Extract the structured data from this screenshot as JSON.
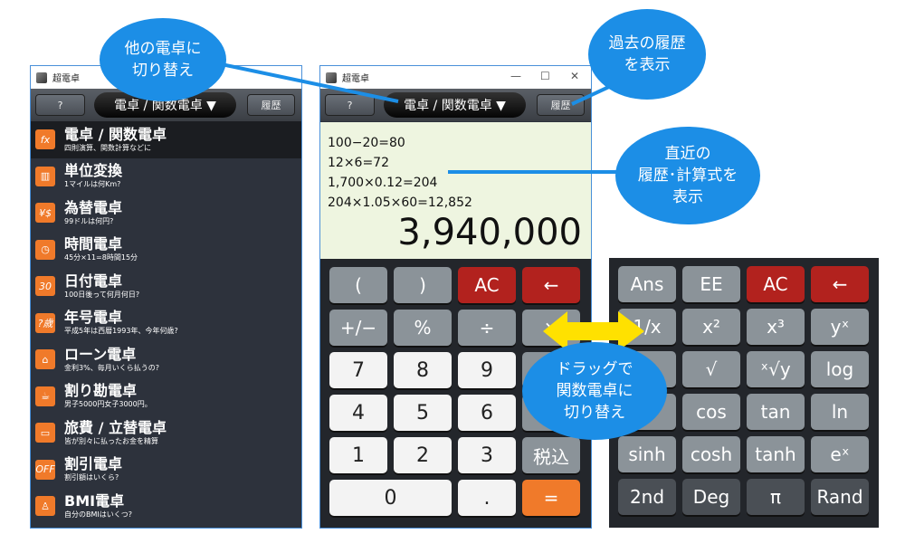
{
  "app_title": "超電卓",
  "toolbar": {
    "help": "?",
    "mode": "電卓 / 関数電卓 ▼",
    "history": "履歴"
  },
  "menu": [
    {
      "title": "電卓 / 関数電卓",
      "sub": "四則演算、関数計算などに",
      "icon": "fx-icon",
      "glyph": "fx",
      "selected": true
    },
    {
      "title": "単位変換",
      "sub": "1マイルは何Km?",
      "icon": "ruler-icon",
      "glyph": "▥"
    },
    {
      "title": "為替電卓",
      "sub": "99ドルは何円?",
      "icon": "currency-icon",
      "glyph": "¥$"
    },
    {
      "title": "時間電卓",
      "sub": "45分×11=8時間15分",
      "icon": "clock-icon",
      "glyph": "◷"
    },
    {
      "title": "日付電卓",
      "sub": "100日後って何月何日?",
      "icon": "calendar-icon",
      "glyph": "30"
    },
    {
      "title": "年号電卓",
      "sub": "平成5年は西暦1993年、今年何歳?",
      "icon": "era-icon",
      "glyph": "?歳"
    },
    {
      "title": "ローン電卓",
      "sub": "金利3%、毎月いくら払うの?",
      "icon": "house-icon",
      "glyph": "⌂"
    },
    {
      "title": "割り勘電卓",
      "sub": "男子5000円女子3000円。",
      "icon": "mug-icon",
      "glyph": "☕"
    },
    {
      "title": "旅費 / 立替電卓",
      "sub": "皆が別々に払ったお金を精算",
      "icon": "money-icon",
      "glyph": "▭"
    },
    {
      "title": "割引電卓",
      "sub": "割引額はいくら?",
      "icon": "discount-icon",
      "glyph": "OFF"
    },
    {
      "title": "BMI電卓",
      "sub": "自分のBMIはいくつ?",
      "icon": "person-icon",
      "glyph": "♙"
    }
  ],
  "display": {
    "history": [
      "100−20=80",
      "12×6=72",
      "1,700×0.12=204",
      "204×1.05×60=12,852"
    ],
    "result": "3,940,000"
  },
  "keypad": [
    [
      "(",
      ")",
      "AC",
      "←"
    ],
    [
      "+/−",
      "%",
      "÷",
      "×"
    ],
    [
      "7",
      "8",
      "9",
      "−"
    ],
    [
      "4",
      "5",
      "6",
      "+"
    ],
    [
      "1",
      "2",
      "3",
      "税込"
    ],
    [
      "0",
      ".",
      "="
    ]
  ],
  "func_keypad": [
    [
      "Ans",
      "EE",
      "AC",
      "←"
    ],
    [
      "1/x",
      "x²",
      "x³",
      "yˣ"
    ],
    [
      "",
      "√",
      "ˣ√y",
      "log"
    ],
    [
      "",
      "cos",
      "tan",
      "ln"
    ],
    [
      "sinh",
      "cosh",
      "tanh",
      "eˣ"
    ],
    [
      "2nd",
      "Deg",
      "π",
      "Rand"
    ]
  ],
  "callouts": {
    "other": "他の電卓に\n切り替え",
    "history": "過去の履歴\nを表示",
    "recent": "直近の\n履歴･計算式を\n表示",
    "drag": "ドラッグで\n関数電卓に\n切り替え"
  },
  "colors": {
    "accent": "#1c8ee6",
    "orange": "#f07a2a",
    "red": "#b2221e",
    "arrow": "#ffe100",
    "display": "#eef5e0"
  }
}
